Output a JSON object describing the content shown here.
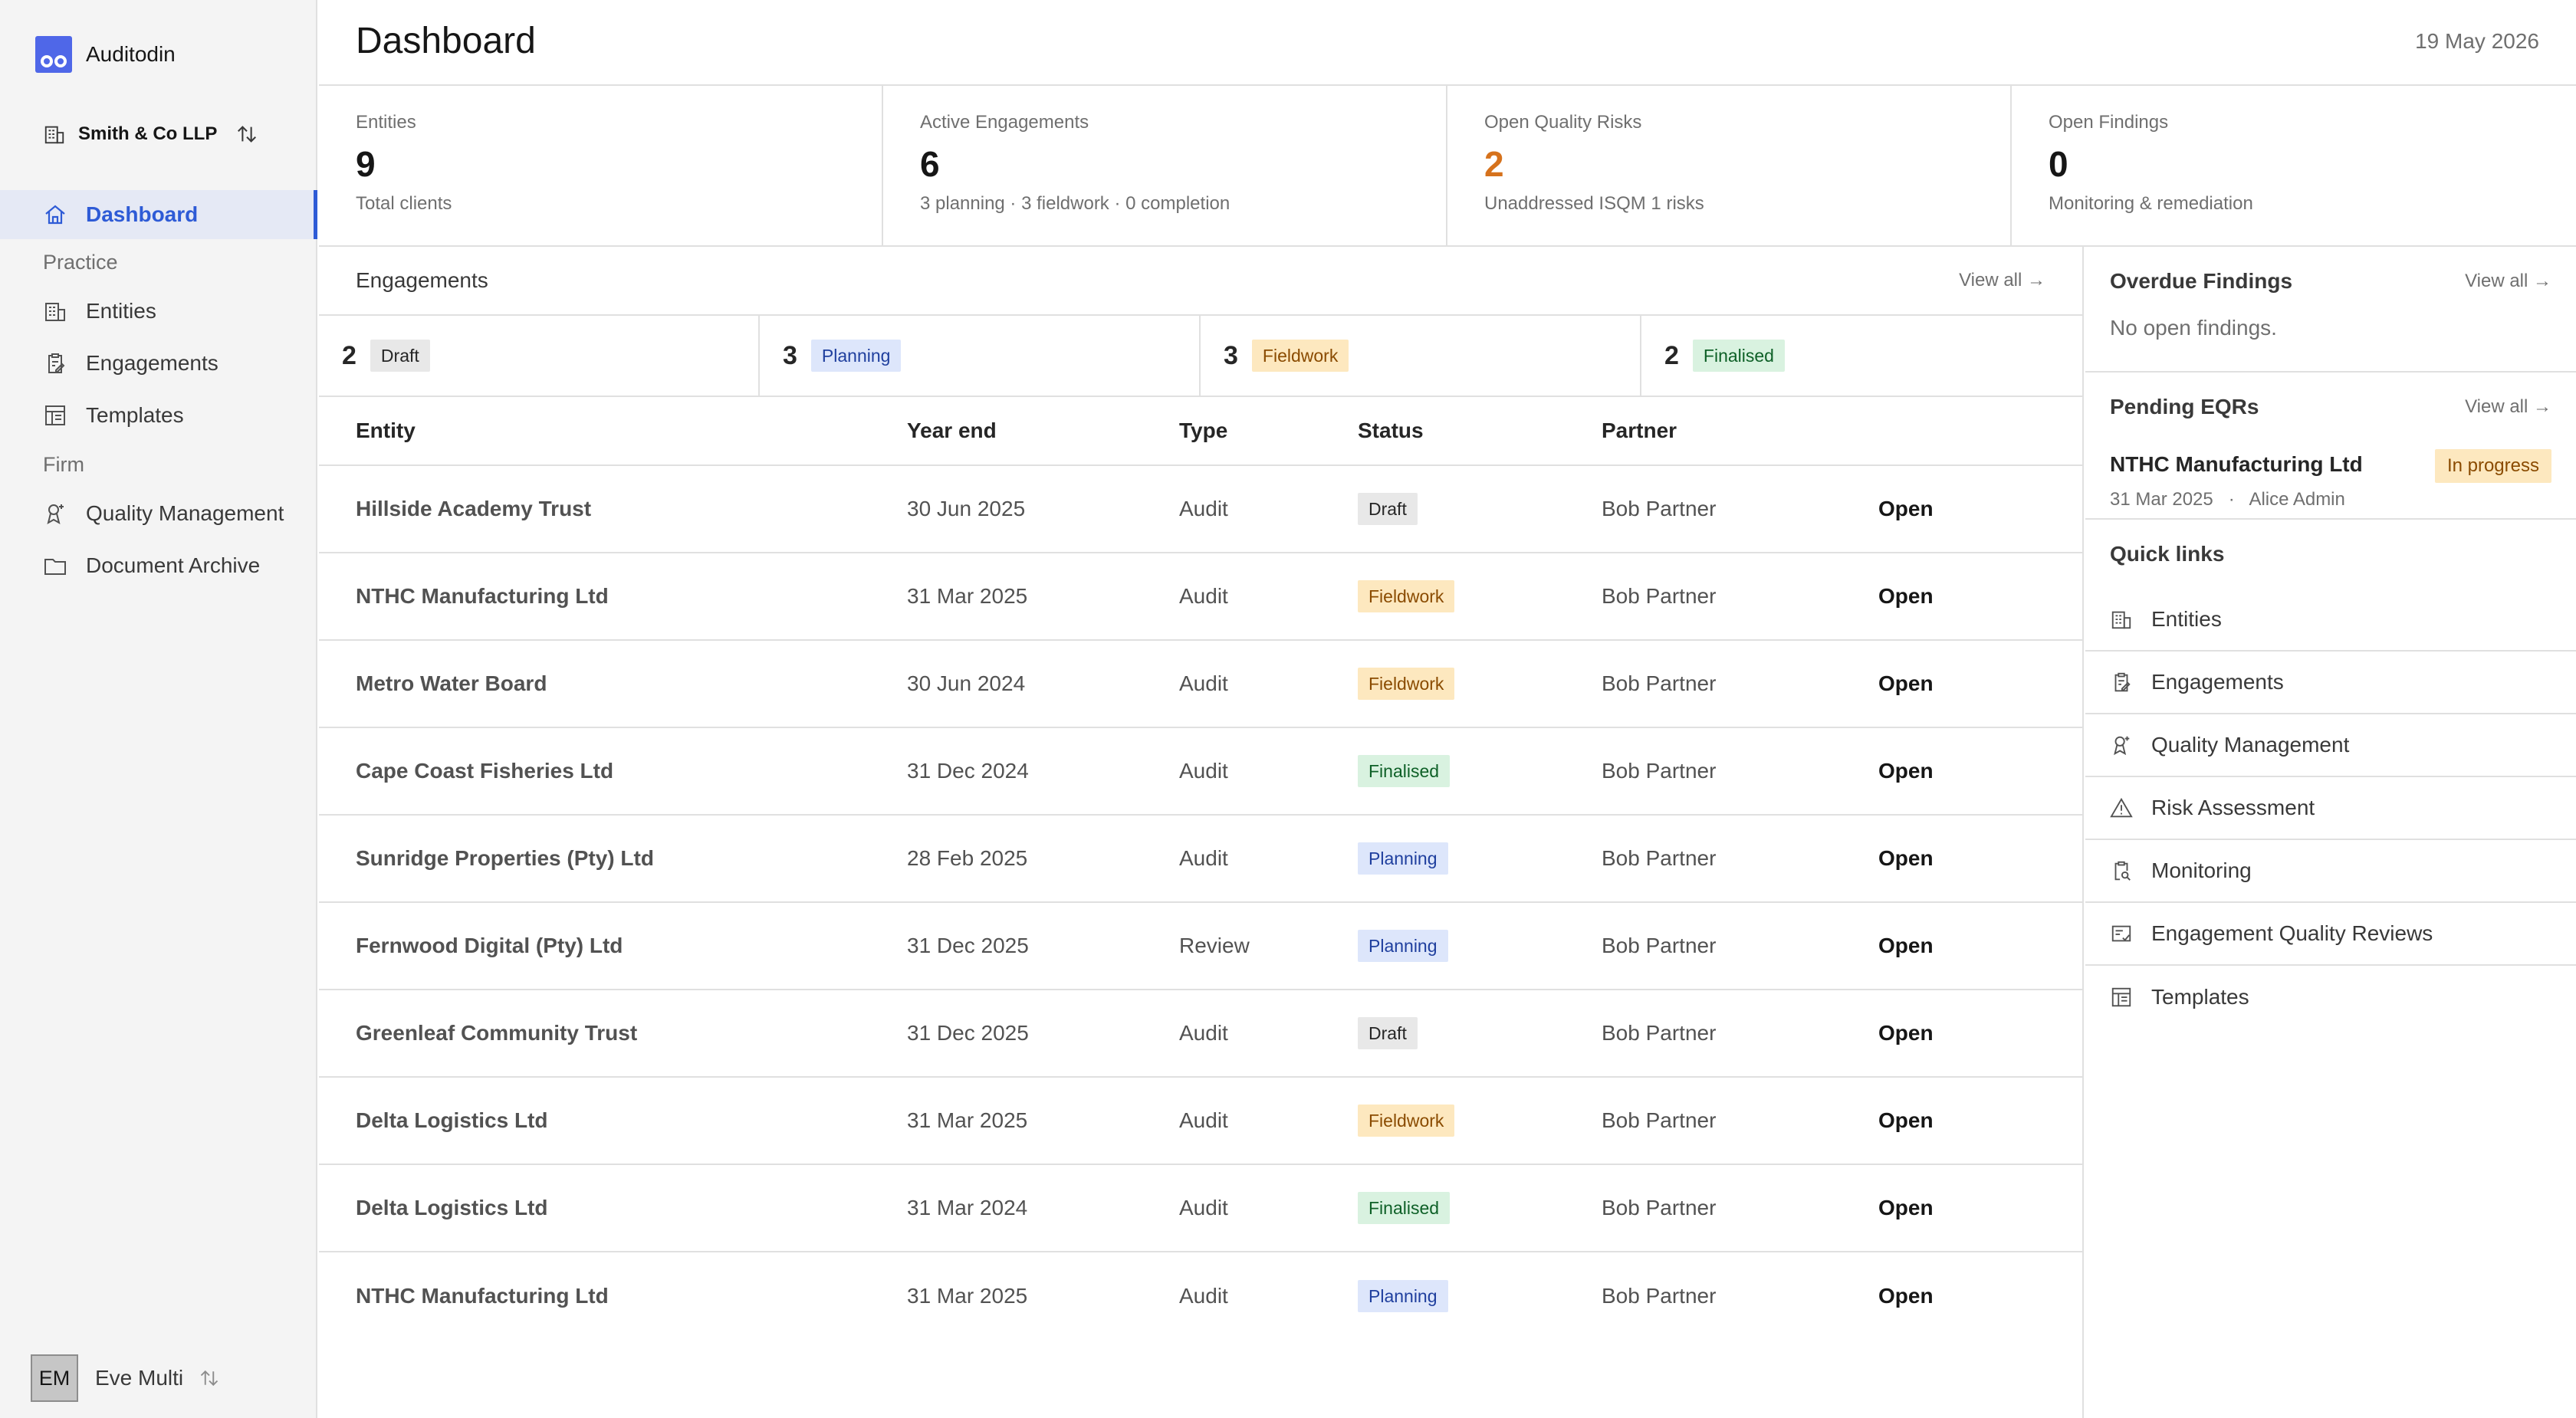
{
  "app": {
    "name": "Auditodin",
    "firm": "Smith & Co LLP",
    "user_initials": "EM",
    "user_name": "Eve Multi"
  },
  "sidebar": {
    "items": [
      {
        "label": "Dashboard",
        "icon": "home-icon"
      },
      {
        "label": "Entities",
        "icon": "building-icon"
      },
      {
        "label": "Engagements",
        "icon": "clipboard-edit-icon"
      },
      {
        "label": "Templates",
        "icon": "template-icon"
      },
      {
        "label": "Quality Management",
        "icon": "ribbon-icon"
      },
      {
        "label": "Document Archive",
        "icon": "folder-icon"
      }
    ],
    "sections": {
      "practice": "Practice",
      "firm": "Firm"
    }
  },
  "header": {
    "title": "Dashboard",
    "date": "19 May 2026"
  },
  "stats": [
    {
      "label": "Entities",
      "value": "9",
      "sub": "Total clients"
    },
    {
      "label": "Active Engagements",
      "value": "6",
      "sub": "3 planning · 3 fieldwork · 0 completion"
    },
    {
      "label": "Open Quality Risks",
      "value": "2",
      "sub": "Unaddressed ISQM 1 risks"
    },
    {
      "label": "Open Findings",
      "value": "0",
      "sub": "Monitoring & remediation"
    }
  ],
  "engagements": {
    "title": "Engagements",
    "view_all": "View all →",
    "status_counts": [
      {
        "count": "2",
        "label": "Draft"
      },
      {
        "count": "3",
        "label": "Planning"
      },
      {
        "count": "3",
        "label": "Fieldwork"
      },
      {
        "count": "2",
        "label": "Finalised"
      }
    ],
    "columns": {
      "entity": "Entity",
      "year_end": "Year end",
      "type": "Type",
      "status": "Status",
      "partner": "Partner"
    },
    "rows": [
      {
        "entity": "Hillside Academy Trust",
        "year_end": "30 Jun 2025",
        "type": "Audit",
        "status": "Draft",
        "partner": "Bob Partner",
        "action": "Open"
      },
      {
        "entity": "NTHC Manufacturing Ltd",
        "year_end": "31 Mar 2025",
        "type": "Audit",
        "status": "Fieldwork",
        "partner": "Bob Partner",
        "action": "Open"
      },
      {
        "entity": "Metro Water Board",
        "year_end": "30 Jun 2024",
        "type": "Audit",
        "status": "Fieldwork",
        "partner": "Bob Partner",
        "action": "Open"
      },
      {
        "entity": "Cape Coast Fisheries Ltd",
        "year_end": "31 Dec 2024",
        "type": "Audit",
        "status": "Finalised",
        "partner": "Bob Partner",
        "action": "Open"
      },
      {
        "entity": "Sunridge Properties (Pty) Ltd",
        "year_end": "28 Feb 2025",
        "type": "Audit",
        "status": "Planning",
        "partner": "Bob Partner",
        "action": "Open"
      },
      {
        "entity": "Fernwood Digital (Pty) Ltd",
        "year_end": "31 Dec 2025",
        "type": "Review",
        "status": "Planning",
        "partner": "Bob Partner",
        "action": "Open"
      },
      {
        "entity": "Greenleaf Community Trust",
        "year_end": "31 Dec 2025",
        "type": "Audit",
        "status": "Draft",
        "partner": "Bob Partner",
        "action": "Open"
      },
      {
        "entity": "Delta Logistics Ltd",
        "year_end": "31 Mar 2025",
        "type": "Audit",
        "status": "Fieldwork",
        "partner": "Bob Partner",
        "action": "Open"
      },
      {
        "entity": "Delta Logistics Ltd",
        "year_end": "31 Mar 2024",
        "type": "Audit",
        "status": "Finalised",
        "partner": "Bob Partner",
        "action": "Open"
      },
      {
        "entity": "NTHC Manufacturing Ltd",
        "year_end": "31 Mar 2025",
        "type": "Audit",
        "status": "Planning",
        "partner": "Bob Partner",
        "action": "Open"
      }
    ]
  },
  "overdue": {
    "title": "Overdue Findings",
    "view_all": "View all →",
    "empty": "No open findings."
  },
  "eqrs": {
    "title": "Pending EQRs",
    "view_all": "View all →",
    "item": {
      "entity": "NTHC Manufacturing Ltd",
      "year_end": "31 Mar 2025",
      "separator": "·",
      "reviewer": "Alice Admin",
      "status": "In progress"
    }
  },
  "quick_links": {
    "title": "Quick links",
    "items": [
      {
        "label": "Entities",
        "icon": "building-icon"
      },
      {
        "label": "Engagements",
        "icon": "clipboard-edit-icon"
      },
      {
        "label": "Quality Management",
        "icon": "ribbon-icon"
      },
      {
        "label": "Risk Assessment",
        "icon": "warning-icon"
      },
      {
        "label": "Monitoring",
        "icon": "clipboard-search-icon"
      },
      {
        "label": "Engagement Quality Reviews",
        "icon": "review-icon"
      },
      {
        "label": "Templates",
        "icon": "template-icon"
      }
    ]
  },
  "colors": {
    "accent": "#2e5bd6",
    "brand": "#4f67e8",
    "warning": "#d6721c",
    "draft": "#e8e8e8",
    "planning": "#dde6fb",
    "fieldwork": "#fde8bf",
    "finalised": "#d9f2e0"
  }
}
